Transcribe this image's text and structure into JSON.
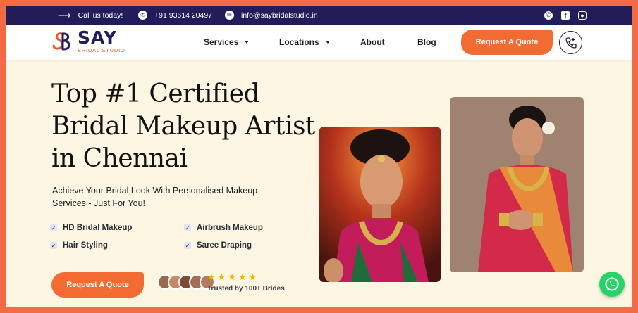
{
  "topbar": {
    "call_label": "Call us today!",
    "phone": "+91 93614 20497",
    "email": "info@saybridalstudio.in",
    "social": [
      "whatsapp-icon",
      "facebook-icon",
      "instagram-icon"
    ]
  },
  "nav": {
    "logo_name": "SAY",
    "logo_sub": "BRIDAL STUDIO",
    "items": [
      {
        "label": "Services",
        "dropdown": true
      },
      {
        "label": "Locations",
        "dropdown": true
      },
      {
        "label": "About",
        "dropdown": false
      },
      {
        "label": "Blog",
        "dropdown": false
      }
    ],
    "quote_label": "Request A Quote"
  },
  "hero": {
    "title_line1": "Top #1 Certified",
    "title_line2": "Bridal Makeup Artist",
    "title_line3": "in Chennai",
    "subtitle": "Achieve Your Bridal Look With Personalised Makeup Services - Just For You!",
    "features": [
      "HD Bridal Makeup",
      "Airbrush Makeup",
      "Hair Styling",
      "Saree Draping"
    ],
    "quote_label": "Request A Quote",
    "rating_stars": 5,
    "trusted_label": "Trusted by 100+ Brides"
  },
  "colors": {
    "brand_navy": "#201d5a",
    "brand_orange": "#f26b32",
    "hero_bg": "#fcf6e3",
    "star": "#f5b400",
    "whatsapp": "#25d366"
  }
}
